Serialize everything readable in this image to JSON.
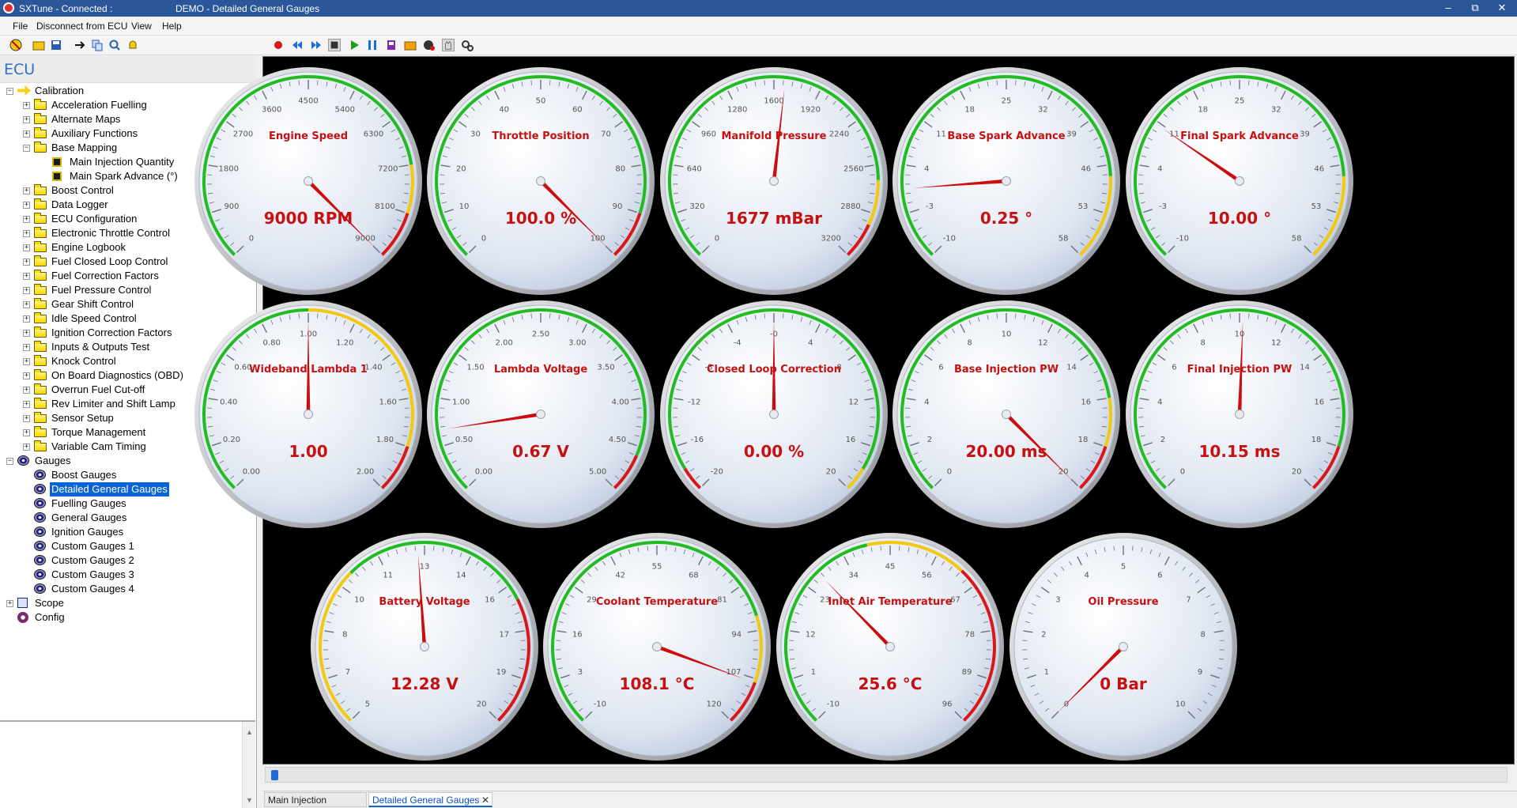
{
  "titlebar": {
    "app_title": "SXTune - Connected :",
    "doc_title": "DEMO - Detailed General Gauges",
    "minimize": "–",
    "maximize": "⧉",
    "close": "✕"
  },
  "menu": [
    "File",
    "Disconnect from ECU",
    "View",
    "Help"
  ],
  "toolbar_icons": [
    "stop-sign-icon",
    "open-folder-icon",
    "save-icon",
    "connect-arrow-icon",
    "copy-icon",
    "search-icon",
    "bell-icon",
    "record-icon",
    "rewind-icon",
    "fast-forward-icon",
    "stop-icon",
    "play-icon",
    "pause-icon",
    "bookmark-icon",
    "folder-icon",
    "gauge-settings-icon",
    "glove-icon",
    "gears-icon"
  ],
  "left": {
    "header": "ECU",
    "tree": [
      {
        "label": "Calibration",
        "level": 0,
        "toggle": "−",
        "icon": "calibration"
      },
      {
        "label": "Acceleration Fuelling",
        "level": 1,
        "toggle": "+",
        "icon": "folder"
      },
      {
        "label": "Alternate Maps",
        "level": 1,
        "toggle": "+",
        "icon": "folder"
      },
      {
        "label": "Auxiliary Functions",
        "level": 1,
        "toggle": "+",
        "icon": "folder"
      },
      {
        "label": "Base Mapping",
        "level": 1,
        "toggle": "−",
        "icon": "folder"
      },
      {
        "label": "Main Injection Quantity",
        "level": 2,
        "toggle": "",
        "icon": "map"
      },
      {
        "label": "Main Spark Advance (°)",
        "level": 2,
        "toggle": "",
        "icon": "map"
      },
      {
        "label": "Boost Control",
        "level": 1,
        "toggle": "+",
        "icon": "folder"
      },
      {
        "label": "Data Logger",
        "level": 1,
        "toggle": "+",
        "icon": "folder"
      },
      {
        "label": "ECU Configuration",
        "level": 1,
        "toggle": "+",
        "icon": "folder"
      },
      {
        "label": "Electronic Throttle Control",
        "level": 1,
        "toggle": "+",
        "icon": "folder"
      },
      {
        "label": "Engine Logbook",
        "level": 1,
        "toggle": "+",
        "icon": "folder"
      },
      {
        "label": "Fuel Closed Loop Control",
        "level": 1,
        "toggle": "+",
        "icon": "folder"
      },
      {
        "label": "Fuel Correction Factors",
        "level": 1,
        "toggle": "+",
        "icon": "folder"
      },
      {
        "label": "Fuel Pressure Control",
        "level": 1,
        "toggle": "+",
        "icon": "folder"
      },
      {
        "label": "Gear Shift Control",
        "level": 1,
        "toggle": "+",
        "icon": "folder"
      },
      {
        "label": "Idle Speed Control",
        "level": 1,
        "toggle": "+",
        "icon": "folder"
      },
      {
        "label": "Ignition Correction Factors",
        "level": 1,
        "toggle": "+",
        "icon": "folder"
      },
      {
        "label": "Inputs & Outputs Test",
        "level": 1,
        "toggle": "+",
        "icon": "folder"
      },
      {
        "label": "Knock Control",
        "level": 1,
        "toggle": "+",
        "icon": "folder"
      },
      {
        "label": "On Board Diagnostics (OBD)",
        "level": 1,
        "toggle": "+",
        "icon": "folder"
      },
      {
        "label": "Overrun Fuel Cut-off",
        "level": 1,
        "toggle": "+",
        "icon": "folder"
      },
      {
        "label": "Rev Limiter and Shift Lamp",
        "level": 1,
        "toggle": "+",
        "icon": "folder"
      },
      {
        "label": "Sensor Setup",
        "level": 1,
        "toggle": "+",
        "icon": "folder"
      },
      {
        "label": "Torque Management",
        "level": 1,
        "toggle": "+",
        "icon": "folder"
      },
      {
        "label": "Variable Cam Timing",
        "level": 1,
        "toggle": "+",
        "icon": "folder"
      },
      {
        "label": "Gauges",
        "level": 0,
        "toggle": "−",
        "icon": "gauge"
      },
      {
        "label": "Boost Gauges",
        "level": 1,
        "toggle": "",
        "icon": "gauge"
      },
      {
        "label": "Detailed General Gauges",
        "level": 1,
        "toggle": "",
        "icon": "gauge",
        "selected": true
      },
      {
        "label": "Fuelling Gauges",
        "level": 1,
        "toggle": "",
        "icon": "gauge"
      },
      {
        "label": "General Gauges",
        "level": 1,
        "toggle": "",
        "icon": "gauge"
      },
      {
        "label": "Ignition Gauges",
        "level": 1,
        "toggle": "",
        "icon": "gauge"
      },
      {
        "label": "Custom Gauges 1",
        "level": 1,
        "toggle": "",
        "icon": "gauge"
      },
      {
        "label": "Custom Gauges 2",
        "level": 1,
        "toggle": "",
        "icon": "gauge"
      },
      {
        "label": "Custom Gauges 3",
        "level": 1,
        "toggle": "",
        "icon": "gauge"
      },
      {
        "label": "Custom Gauges 4",
        "level": 1,
        "toggle": "",
        "icon": "gauge"
      },
      {
        "label": "Scope",
        "level": 0,
        "toggle": "+",
        "icon": "scope"
      },
      {
        "label": "Config",
        "level": 0,
        "toggle": "",
        "icon": "config"
      }
    ],
    "scroll_up": "▲",
    "scroll_down": "▼"
  },
  "gauges": [
    {
      "name": "engine-speed",
      "title": "Engine Speed",
      "value": 9000,
      "display": "9000 RPM",
      "min": 0,
      "max": 9000,
      "ticks": [
        "0",
        "900",
        "1800",
        "2700",
        "3600",
        "4500",
        "5400",
        "6300",
        "7200",
        "8100",
        "9000"
      ],
      "bands": [
        {
          "from": 0,
          "to": 7200,
          "color": "#22bb22"
        },
        {
          "from": 7200,
          "to": 8100,
          "color": "#f2c811"
        },
        {
          "from": 8100,
          "to": 9000,
          "color": "#d81818"
        }
      ]
    },
    {
      "name": "throttle-position",
      "title": "Throttle Position",
      "value": 100,
      "display": "100.0 %",
      "min": 0,
      "max": 100,
      "ticks": [
        "0",
        "10",
        "20",
        "30",
        "40",
        "50",
        "60",
        "70",
        "80",
        "90",
        "100"
      ],
      "bands": [
        {
          "from": 0,
          "to": 90,
          "color": "#22bb22"
        },
        {
          "from": 90,
          "to": 100,
          "color": "#d81818"
        }
      ]
    },
    {
      "name": "manifold-pressure",
      "title": "Manifold Pressure",
      "value": 1677,
      "display": "1677 mBar",
      "min": 0,
      "max": 3200,
      "ticks": [
        "0",
        "320",
        "640",
        "960",
        "1280",
        "1600",
        "1920",
        "2240",
        "2560",
        "2880",
        "3200"
      ],
      "bands": [
        {
          "from": 0,
          "to": 2660,
          "color": "#22bb22"
        },
        {
          "from": 2660,
          "to": 2960,
          "color": "#f2c811"
        },
        {
          "from": 2960,
          "to": 3200,
          "color": "#d81818"
        }
      ]
    },
    {
      "name": "base-spark-advance",
      "title": "Base Spark Advance",
      "value": 0.25,
      "display": "0.25 °",
      "min": -10,
      "max": 58,
      "ticks": [
        "-10",
        "-3",
        "4",
        "11",
        "18",
        "25",
        "32",
        "39",
        "46",
        "53",
        "58"
      ],
      "bands": [
        {
          "from": -10,
          "to": 46,
          "color": "#22bb22"
        },
        {
          "from": 46,
          "to": 58,
          "color": "#f2c811"
        }
      ]
    },
    {
      "name": "final-spark-advance",
      "title": "Final Spark Advance",
      "value": 10,
      "display": "10.00 °",
      "min": -10,
      "max": 58,
      "ticks": [
        "-10",
        "-3",
        "4",
        "11",
        "18",
        "25",
        "32",
        "39",
        "46",
        "53",
        "58"
      ],
      "bands": [
        {
          "from": -10,
          "to": 46,
          "color": "#22bb22"
        },
        {
          "from": 46,
          "to": 58,
          "color": "#f2c811"
        }
      ]
    },
    {
      "name": "wideband-lambda-1",
      "title": "Wideband Lambda 1",
      "value": 1.0,
      "display": "1.00",
      "min": 0,
      "max": 2,
      "ticks": [
        "0.00",
        "0.20",
        "0.40",
        "0.60",
        "0.80",
        "1.00",
        "1.20",
        "1.40",
        "1.60",
        "1.80",
        "2.00"
      ],
      "bands": [
        {
          "from": 0,
          "to": 1.0,
          "color": "#22bb22"
        },
        {
          "from": 1.0,
          "to": 1.8,
          "color": "#f2c811"
        },
        {
          "from": 1.8,
          "to": 2.0,
          "color": "#d81818"
        }
      ]
    },
    {
      "name": "lambda-voltage",
      "title": "Lambda Voltage",
      "value": 0.67,
      "display": "0.67 V",
      "min": 0,
      "max": 5,
      "ticks": [
        "0.00",
        "0.50",
        "1.00",
        "1.50",
        "2.00",
        "2.50",
        "3.00",
        "3.50",
        "4.00",
        "4.50",
        "5.00"
      ],
      "bands": [
        {
          "from": 0,
          "to": 4.6,
          "color": "#22bb22"
        },
        {
          "from": 4.6,
          "to": 5,
          "color": "#d81818"
        }
      ]
    },
    {
      "name": "closed-loop-correction",
      "title": "Closed Loop Correction",
      "value": 0,
      "display": "0.00 %",
      "min": -20,
      "max": 20,
      "ticks": [
        "-20",
        "-16",
        "-12",
        "-8",
        "-4",
        "-0",
        "4",
        "8",
        "12",
        "16",
        "20"
      ],
      "bands": [
        {
          "from": -20,
          "to": -18,
          "color": "#d81818"
        },
        {
          "from": -18,
          "to": 18,
          "color": "#22bb22"
        },
        {
          "from": 18,
          "to": 20,
          "color": "#f2c811"
        }
      ]
    },
    {
      "name": "base-injection-pw",
      "title": "Base Injection PW",
      "value": 20,
      "display": "20.00 ms",
      "min": 0,
      "max": 20,
      "ticks": [
        "0",
        "2",
        "4",
        "6",
        "8",
        "10",
        "12",
        "14",
        "16",
        "18",
        "20"
      ],
      "bands": [
        {
          "from": 0,
          "to": 16,
          "color": "#22bb22"
        },
        {
          "from": 16,
          "to": 18,
          "color": "#f2c811"
        },
        {
          "from": 18,
          "to": 20,
          "color": "#d81818"
        }
      ]
    },
    {
      "name": "final-injection-pw",
      "title": "Final Injection PW",
      "value": 10.15,
      "display": "10.15 ms",
      "min": 0,
      "max": 20,
      "ticks": [
        "0",
        "2",
        "4",
        "6",
        "8",
        "10",
        "12",
        "14",
        "16",
        "18",
        "20"
      ],
      "bands": [
        {
          "from": 0,
          "to": 18,
          "color": "#22bb22"
        },
        {
          "from": 18,
          "to": 20,
          "color": "#d81818"
        }
      ]
    },
    {
      "name": "battery-voltage",
      "title": "Battery Voltage",
      "value": 12.28,
      "display": "12.28 V",
      "min": 5,
      "max": 20,
      "ticks": [
        "5",
        "7",
        "8",
        "10",
        "11",
        "13",
        "14",
        "16",
        "17",
        "19",
        "20"
      ],
      "bands": [
        {
          "from": 5,
          "to": 10,
          "color": "#f2c811"
        },
        {
          "from": 10,
          "to": 16,
          "color": "#22bb22"
        },
        {
          "from": 16,
          "to": 20,
          "color": "#d81818"
        }
      ]
    },
    {
      "name": "coolant-temperature",
      "title": "Coolant Temperature",
      "value": 108.1,
      "display": "108.1 °C",
      "min": -10,
      "max": 120,
      "ticks": [
        "-10",
        "3",
        "16",
        "29",
        "42",
        "55",
        "68",
        "81",
        "94",
        "107",
        "120"
      ],
      "bands": [
        {
          "from": -10,
          "to": 90,
          "color": "#22bb22"
        },
        {
          "from": 90,
          "to": 108,
          "color": "#f2c811"
        },
        {
          "from": 108,
          "to": 120,
          "color": "#d81818"
        }
      ]
    },
    {
      "name": "inlet-air-temperature",
      "title": "Inlet Air Temperature",
      "value": 25.6,
      "display": "25.6 °C",
      "min": -10,
      "max": 96,
      "ticks": [
        "-10",
        "1",
        "12",
        "23",
        "34",
        "45",
        "56",
        "67",
        "78",
        "89",
        "96"
      ],
      "bands": [
        {
          "from": -10,
          "to": 38,
          "color": "#22bb22"
        },
        {
          "from": 38,
          "to": 60,
          "color": "#f2c811"
        },
        {
          "from": 60,
          "to": 96,
          "color": "#d81818"
        }
      ]
    },
    {
      "name": "oil-pressure",
      "title": "Oil Pressure",
      "value": 0,
      "display": "0 Bar",
      "min": 0,
      "max": 10,
      "ticks": [
        "0",
        "1",
        "2",
        "3",
        "4",
        "5",
        "6",
        "7",
        "8",
        "9",
        "10"
      ],
      "bands": []
    }
  ],
  "tabs": [
    {
      "label": "Main Injection Quantity",
      "active": false
    },
    {
      "label": "Detailed General Gauges",
      "active": true,
      "close": "✕"
    }
  ]
}
